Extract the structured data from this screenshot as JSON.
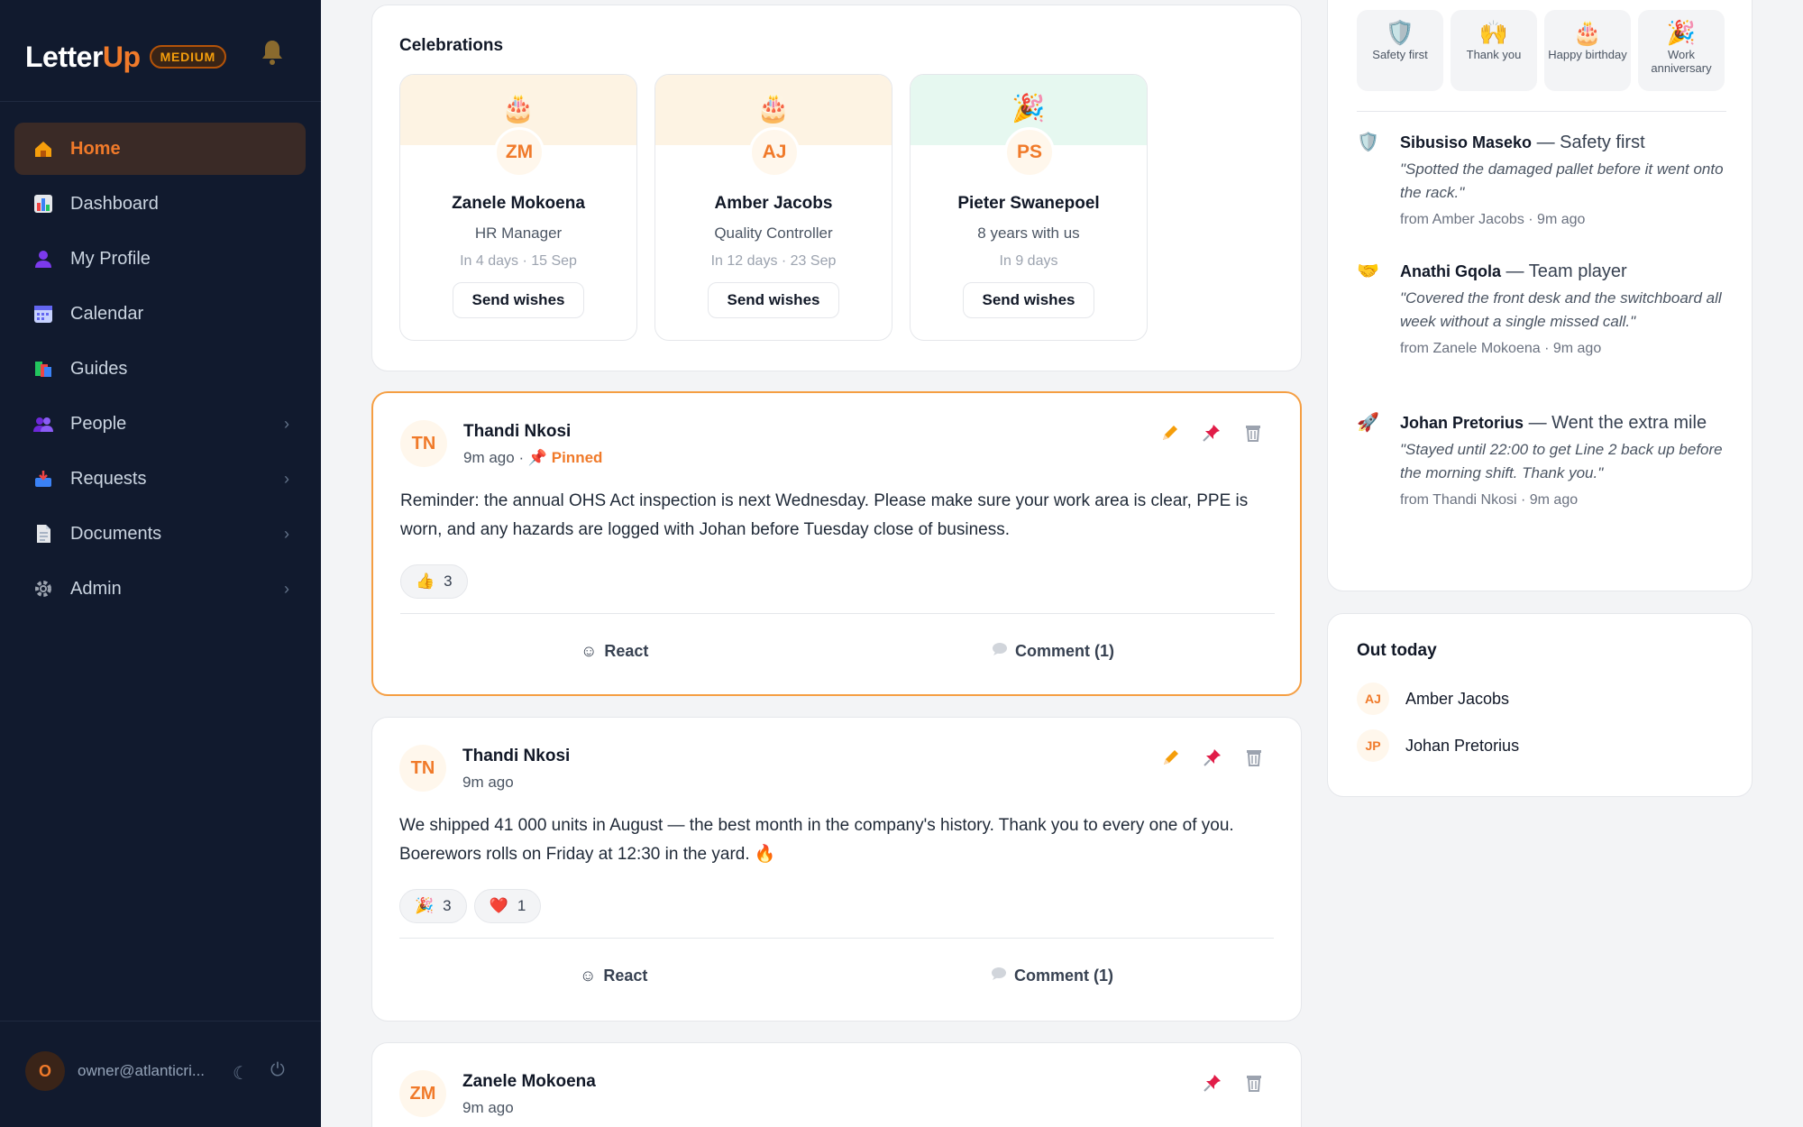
{
  "sidebar": {
    "brand_prefix": "Letter",
    "brand_suffix": "Up",
    "plan_badge": "MEDIUM",
    "items": [
      {
        "label": "Home",
        "icon": "house-icon"
      },
      {
        "label": "Dashboard",
        "icon": "bar-chart-icon"
      },
      {
        "label": "My Profile",
        "icon": "person-icon"
      },
      {
        "label": "Calendar",
        "icon": "calendar-icon"
      },
      {
        "label": "Guides",
        "icon": "books-icon"
      },
      {
        "label": "People",
        "icon": "people-icon"
      },
      {
        "label": "Requests",
        "icon": "inbox-tray-icon"
      },
      {
        "label": "Documents",
        "icon": "document-icon"
      },
      {
        "label": "Admin",
        "icon": "gear-icon"
      }
    ],
    "user": {
      "initial": "O",
      "email": "owner@atlanticri..."
    }
  },
  "celebrations": {
    "title": "Celebrations",
    "items": [
      {
        "emoji": "🎂",
        "initials": "ZM",
        "name": "Zanele Mokoena",
        "role": "HR Manager",
        "when": "In 4 days · 15 Sep",
        "button": "Send wishes"
      },
      {
        "emoji": "🎂",
        "initials": "AJ",
        "name": "Amber Jacobs",
        "role": "Quality Controller",
        "when": "In 12 days · 23 Sep",
        "button": "Send wishes"
      },
      {
        "emoji": "🎉",
        "initials": "PS",
        "name": "Pieter Swanepoel",
        "role": "8 years with us",
        "when": "In 9 days",
        "button": "Send wishes"
      }
    ]
  },
  "posts": [
    {
      "initials": "TN",
      "author": "Thandi Nkosi",
      "time": "9m ago",
      "separator": "·",
      "pin_emoji": "📌",
      "pinned_label": "Pinned",
      "body": "Reminder: the annual OHS Act inspection is next Wednesday. Please make sure your work area is clear, PPE is worn, and any hazards are logged with Johan before Tuesday close of business.",
      "reactions": [
        {
          "emoji": "👍",
          "count": "3"
        }
      ],
      "react_label": "React",
      "comment_label": "Comment (1)"
    },
    {
      "initials": "TN",
      "author": "Thandi Nkosi",
      "time": "9m ago",
      "body": "We shipped 41 000 units in August — the best month in the company's history. Thank you to every one of you. Boerewors rolls on Friday at 12:30 in the yard. 🔥",
      "reactions": [
        {
          "emoji": "🎉",
          "count": "3"
        },
        {
          "emoji": "❤️",
          "count": "1"
        }
      ],
      "react_label": "React",
      "comment_label": "Comment (1)"
    },
    {
      "initials": "ZM",
      "author": "Zanele Mokoena",
      "time": "9m ago"
    }
  ],
  "kudos": {
    "types": [
      {
        "emoji": "🛡️",
        "label": "Safety first"
      },
      {
        "emoji": "🙌",
        "label": "Thank you"
      },
      {
        "emoji": "🎂",
        "label": "Happy birthday"
      },
      {
        "emoji": "🎉",
        "label": "Work anniversary"
      }
    ],
    "items": [
      {
        "emoji": "🛡️",
        "name": "Sibusiso Maseko",
        "type": " — Safety first",
        "quote": "\"Spotted the damaged pallet before it went onto the rack.\"",
        "from": "from Amber Jacobs · 9m ago"
      },
      {
        "emoji": "🤝",
        "name": "Anathi Gqola",
        "type": " — Team player",
        "quote": "\"Covered the front desk and the switchboard all week without a single missed call.\"",
        "from": "from Zanele Mokoena · 9m ago"
      },
      {
        "emoji": "🚀",
        "name": "Johan Pretorius",
        "type": " — Went the extra mile",
        "quote": "\"Stayed until 22:00 to get Line 2 back up before the morning shift. Thank you.\"",
        "from": "from Thandi Nkosi · 9m ago"
      }
    ]
  },
  "out_today": {
    "title": "Out today",
    "people": [
      {
        "initials": "AJ",
        "name": "Amber Jacobs"
      },
      {
        "initials": "JP",
        "name": "Johan Pretorius"
      }
    ]
  },
  "colors": {
    "accent": "#f07a2a",
    "sidebar_bg": "#111a2e",
    "pinned_border": "#f59e42"
  }
}
